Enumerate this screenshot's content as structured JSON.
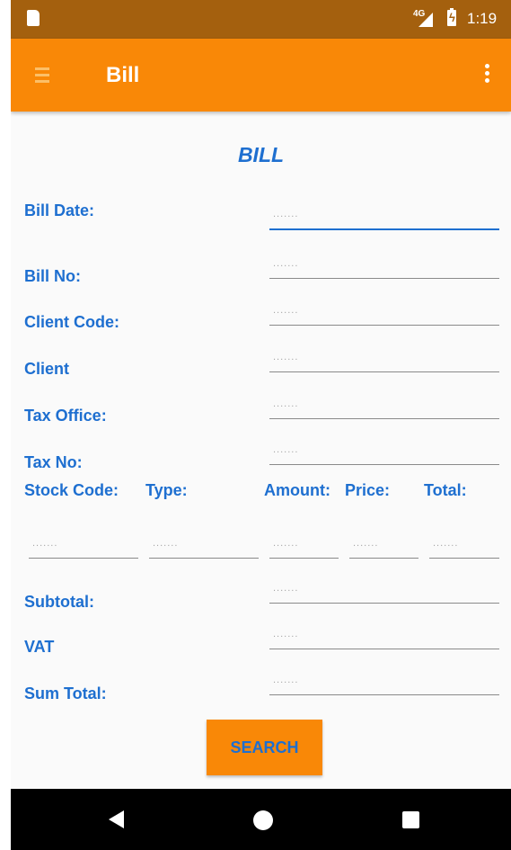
{
  "status_bar": {
    "network": "4G",
    "time": "1:19"
  },
  "toolbar": {
    "title": "Bill"
  },
  "form": {
    "title": "BILL",
    "placeholder": ".......",
    "bill_date_label": "Bill Date:",
    "bill_no_label": "Bill No:",
    "client_code_label": "Client Code:",
    "client_label": "Client",
    "tax_office_label": "Tax Office:",
    "tax_no_label": "Tax No:",
    "stock_code_label": "Stock Code:",
    "type_label": "Type:",
    "amount_label": "Amount:",
    "price_label": "Price:",
    "total_label": "Total:",
    "subtotal_label": "Subtotal:",
    "vat_label": "VAT",
    "sum_total_label": "Sum Total:",
    "search_label": "SEARCH"
  },
  "colors": {
    "accent": "#f98807",
    "status_bar": "#a4600e",
    "label_blue": "#1e6fd0",
    "navbar": "#000000"
  },
  "icons": [
    "sim-card-icon",
    "signal-icon",
    "battery-charging-icon",
    "menu-icon",
    "more-vert-icon",
    "back-icon",
    "home-icon",
    "recents-icon"
  ]
}
